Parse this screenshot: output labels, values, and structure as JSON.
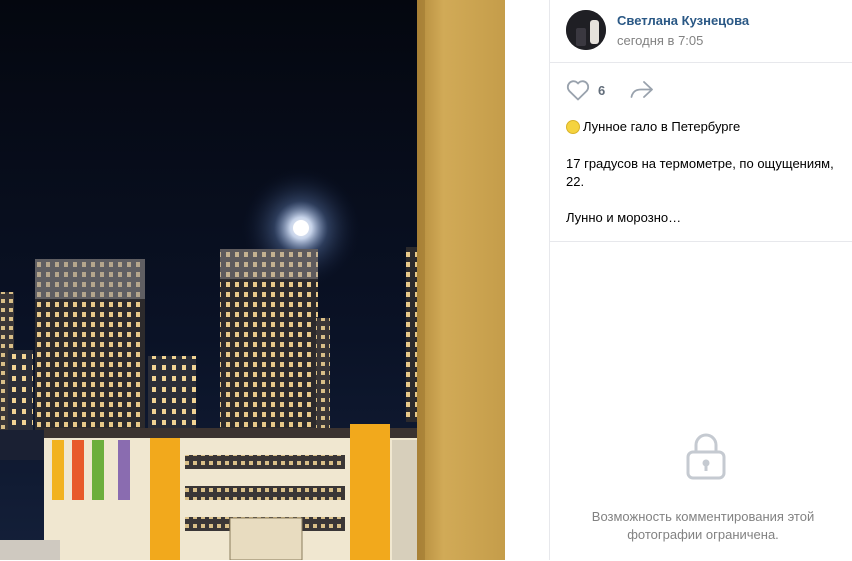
{
  "post": {
    "author": "Светлана Кузнецова",
    "time": "сегодня в 7:05",
    "likes": "6",
    "text_line1": "Лунное гало в Петербурге",
    "text_line2": "17 градусов на термометре, по ощущениям, 22.",
    "text_line3": "Лунно и морозно…"
  },
  "comments": {
    "restriction_text": "Возможность комментирования этой фотографии ограничена."
  },
  "icons": {
    "like": "heart-icon",
    "share": "share-arrow-icon",
    "lock": "lock-icon",
    "emoji": "moon-emoji"
  },
  "colors": {
    "author": "#2a5885",
    "muted": "#828282",
    "icon": "#99a2ad",
    "wall": "#c9a24a"
  }
}
